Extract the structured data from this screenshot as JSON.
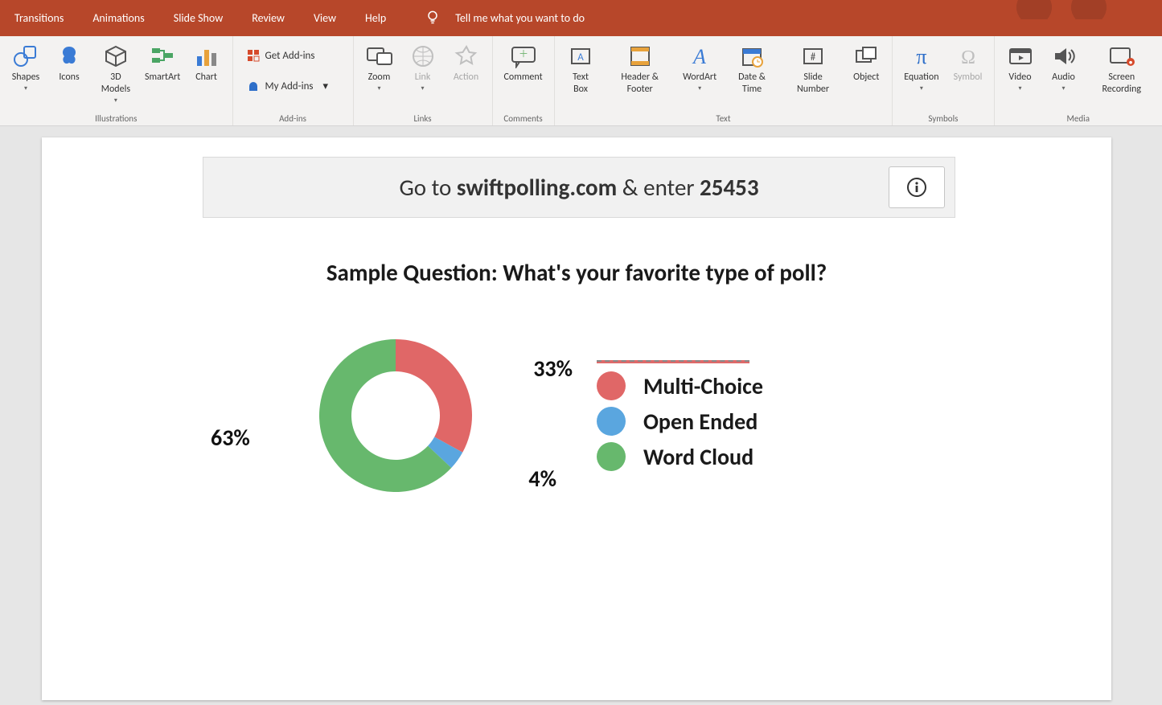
{
  "tabs": [
    "Transitions",
    "Animations",
    "Slide Show",
    "Review",
    "View",
    "Help"
  ],
  "tell_me": "Tell me what you want to do",
  "ribbon": {
    "illustrations": {
      "label": "Illustrations",
      "shapes": "Shapes",
      "icons": "Icons",
      "models": "3D Models",
      "smartart": "SmartArt",
      "chart": "Chart"
    },
    "addins": {
      "label": "Add-ins",
      "get": "Get Add-ins",
      "my": "My Add-ins"
    },
    "links": {
      "label": "Links",
      "zoom": "Zoom",
      "link": "Link",
      "action": "Action"
    },
    "comments": {
      "label": "Comments",
      "comment": "Comment"
    },
    "text": {
      "label": "Text",
      "textbox": "Text Box",
      "header": "Header & Footer",
      "wordart": "WordArt",
      "datetime": "Date & Time",
      "slidenum": "Slide Number",
      "object": "Object"
    },
    "symbols": {
      "label": "Symbols",
      "equation": "Equation",
      "symbol": "Symbol"
    },
    "media": {
      "label": "Media",
      "video": "Video",
      "audio": "Audio",
      "screen": "Screen Recording"
    }
  },
  "slide": {
    "banner_prefix": "Go to ",
    "banner_site": "swiftpolling.com",
    "banner_mid": " & enter ",
    "banner_code": "25453",
    "question": "Sample Question: What's your favorite type of poll?",
    "legend": {
      "multi": "Multi-Choice",
      "open": "Open Ended",
      "word": "Word Cloud"
    }
  },
  "chart_data": {
    "type": "pie",
    "title": "Sample Question: What's your favorite type of poll?",
    "categories": [
      "Multi-Choice",
      "Open Ended",
      "Word Cloud"
    ],
    "values": [
      33,
      4,
      63
    ],
    "colors": {
      "Multi-Choice": "#e06767",
      "Open Ended": "#5aa6df",
      "Word Cloud": "#67b86d"
    },
    "value_labels": [
      "33%",
      "4%",
      "63%"
    ]
  }
}
